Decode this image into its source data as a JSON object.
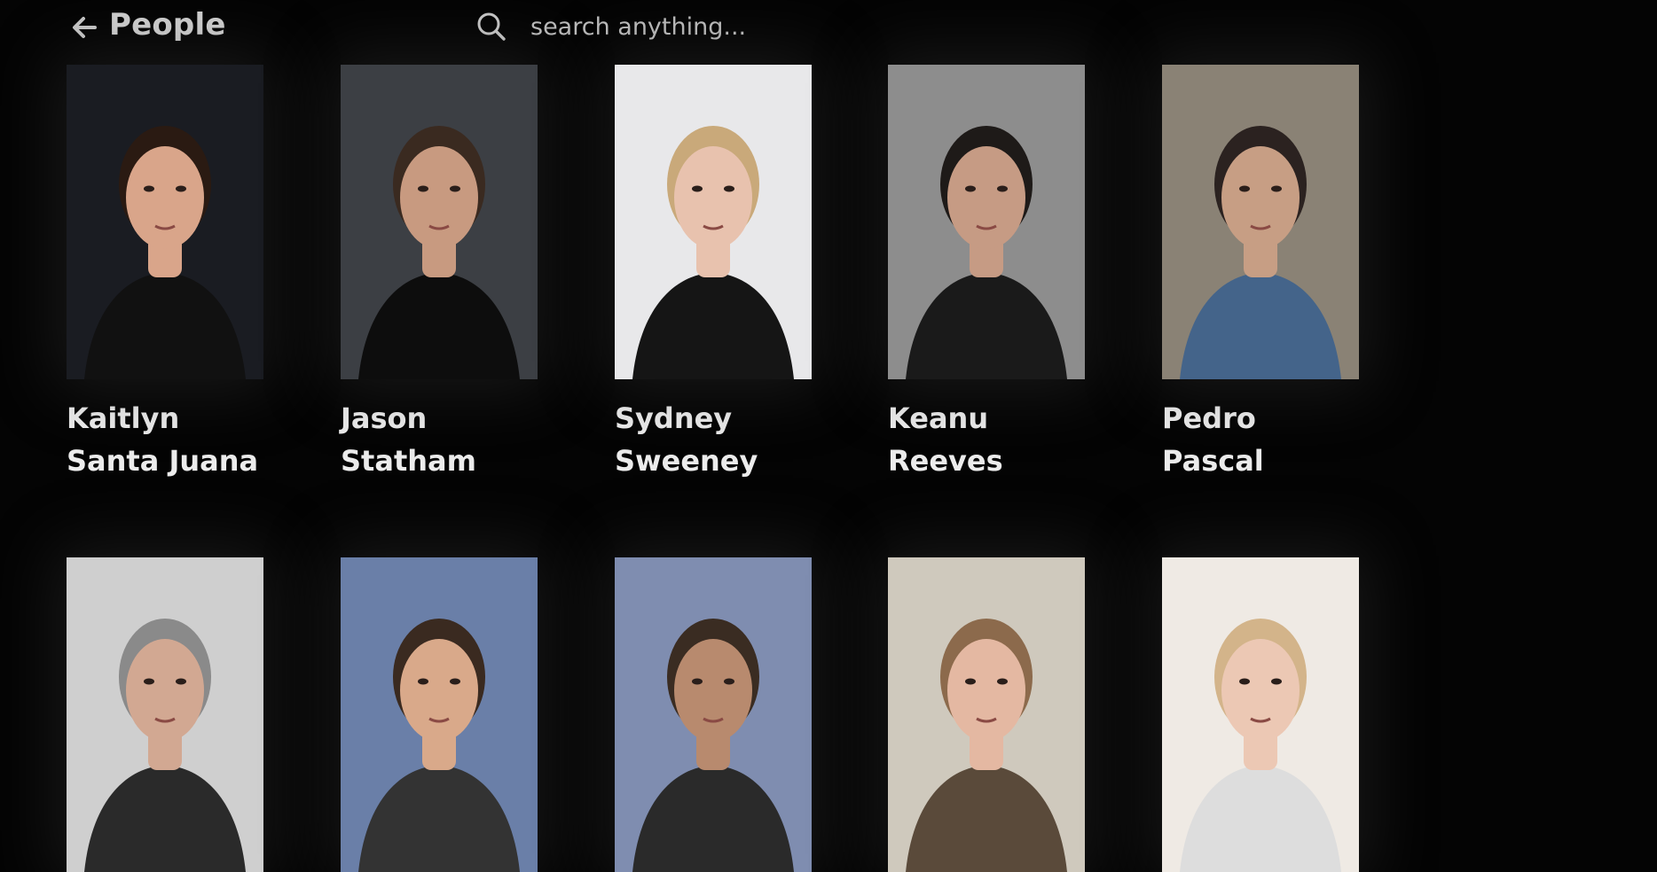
{
  "header": {
    "title": "People",
    "back_icon": "arrow-left-icon",
    "search_icon": "search-icon",
    "search_placeholder": "search anything..."
  },
  "people": [
    {
      "name": "Kaitlyn Santa Juana",
      "bg": "#1a1c22",
      "skin": "#d9a58a",
      "hair": "#2a1a12",
      "cloth": "#111111"
    },
    {
      "name": "Jason Statham",
      "bg": "#3c3f44",
      "skin": "#c89a80",
      "hair": "#3a2a20",
      "cloth": "#0d0d0d"
    },
    {
      "name": "Sydney Sweeney",
      "bg": "#e8e8ea",
      "skin": "#e8c2ae",
      "hair": "#c9a97a",
      "cloth": "#151515"
    },
    {
      "name": "Keanu Reeves",
      "bg": "#8d8d8d",
      "skin": "#c69b84",
      "hair": "#1e1a18",
      "cloth": "#1a1a1a"
    },
    {
      "name": "Pedro Pascal",
      "bg": "#8a8275",
      "skin": "#c79e84",
      "hair": "#2b2220",
      "cloth": "#44648a"
    },
    {
      "name": "",
      "bg": "#cfcfcf",
      "skin": "#d2a892",
      "hair": "#8a8a8a",
      "cloth": "#2a2a2a"
    },
    {
      "name": "",
      "bg": "#6a7fa8",
      "skin": "#d9a98a",
      "hair": "#3a2a20",
      "cloth": "#333333"
    },
    {
      "name": "",
      "bg": "#7f8db0",
      "skin": "#b88a6e",
      "hair": "#3a2c22",
      "cloth": "#2a2a2a"
    },
    {
      "name": "",
      "bg": "#cfc9bd",
      "skin": "#e4b8a2",
      "hair": "#8c6a4c",
      "cloth": "#5a4a3a"
    },
    {
      "name": "",
      "bg": "#efeae4",
      "skin": "#ecc8b4",
      "hair": "#d3b48a",
      "cloth": "#dddddd"
    }
  ]
}
